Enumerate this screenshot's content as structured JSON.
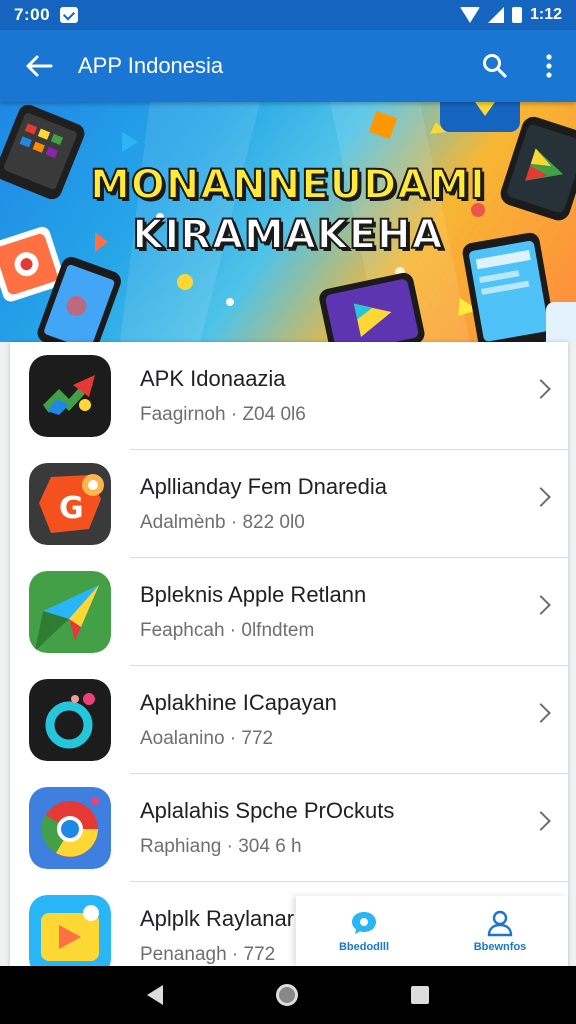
{
  "status_bar": {
    "time": "7:00",
    "clock_right": "1:12"
  },
  "app_bar": {
    "title": "APP Indonesia"
  },
  "banner": {
    "title_line1": "MONANNEUDAMI",
    "title_line2": "KIRAMAKEHA"
  },
  "apps": [
    {
      "name": "APK Idonaazia",
      "meta": "Faagirnoh · Z04 0l6",
      "icon": "colorful-chart-arrow-icon"
    },
    {
      "name": "Aplliandaу Fem Dnaredia",
      "meta": "Adalmènb · 822 0l0",
      "icon": "orange-g-bubble-icon"
    },
    {
      "name": "Bpleknis Apple Retlann",
      "meta": "Feaphcah · 0lfndtem",
      "icon": "paper-plane-icon"
    },
    {
      "name": "Aplakhine ICapayan",
      "meta": "Aoalanino · 772",
      "icon": "camera-lens-icon"
    },
    {
      "name": "Aplalahis Spche PrOckuts",
      "meta": "Raphiang · 304 6 h",
      "icon": "chrome-like-icon"
    },
    {
      "name": "Aplplk Raylanar",
      "meta": "Penanagh · 772",
      "icon": "video-play-icon"
    }
  ],
  "mini_nav": [
    {
      "label": "Bbedodlll",
      "icon": "chat-bubble-icon"
    },
    {
      "label": "Bbewnfos",
      "icon": "profile-icon"
    }
  ],
  "colors": {
    "primary": "#1976d2",
    "status_bar": "#1565c0"
  }
}
